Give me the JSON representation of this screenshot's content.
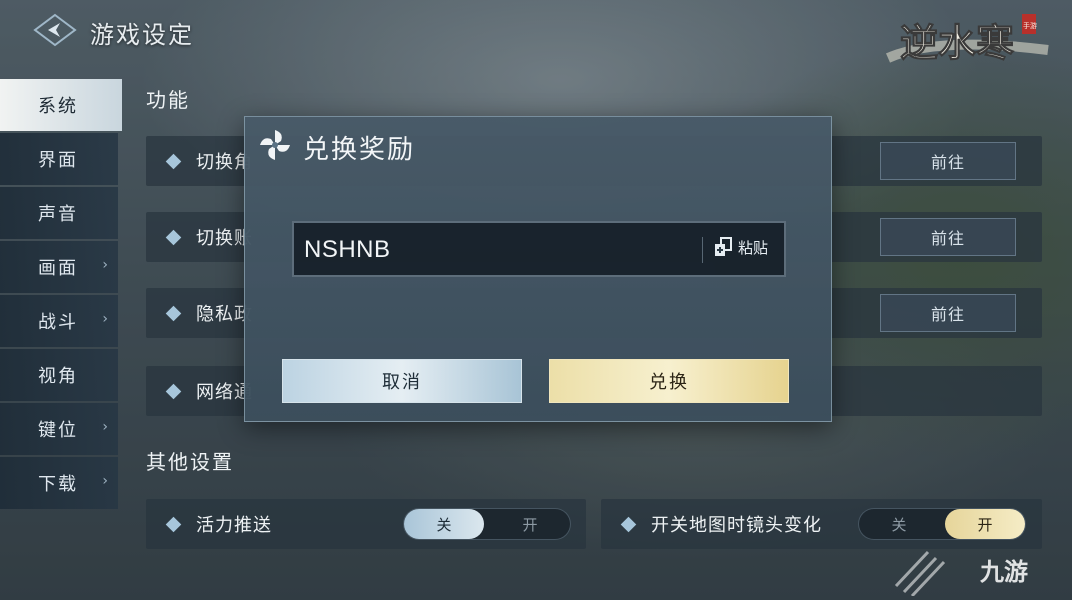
{
  "header": {
    "title": "游戏设定",
    "logo_text": "逆水寒",
    "logo_subtext": "手游"
  },
  "sidebar": {
    "items": [
      {
        "label": "系统",
        "active": true,
        "has_chevron": false
      },
      {
        "label": "界面",
        "active": false,
        "has_chevron": false
      },
      {
        "label": "声音",
        "active": false,
        "has_chevron": false
      },
      {
        "label": "画面",
        "active": false,
        "has_chevron": true
      },
      {
        "label": "战斗",
        "active": false,
        "has_chevron": true
      },
      {
        "label": "视角",
        "active": false,
        "has_chevron": false
      },
      {
        "label": "键位",
        "active": false,
        "has_chevron": true
      },
      {
        "label": "下载",
        "active": false,
        "has_chevron": true
      }
    ],
    "chevron": "›"
  },
  "content": {
    "section_function": "功能",
    "rows": [
      {
        "label": "切换角",
        "button": "前往"
      },
      {
        "label": "切换账",
        "button": "前往"
      },
      {
        "label": "隐私政",
        "button": "前往"
      },
      {
        "label": "网络通"
      }
    ],
    "section_other": "其他设置",
    "toggles": [
      {
        "label": "活力推送",
        "off": "关",
        "on": "开",
        "state": "off"
      },
      {
        "label": "开关地图时镜头变化",
        "off": "关",
        "on": "开",
        "state": "on"
      }
    ]
  },
  "modal": {
    "title": "兑换奖励",
    "code_value": "NSHNB",
    "paste_label": "粘贴",
    "cancel_label": "取消",
    "exchange_label": "兑换"
  },
  "watermark": {
    "text": "九游"
  },
  "colors": {
    "cancel_button": "#d3e3ec",
    "exchange_button": "#f2e8bf",
    "toggle_on_blue": "#c5d9e6",
    "toggle_on_gold": "#f0e4b0",
    "diamond": "#a7c6db"
  }
}
